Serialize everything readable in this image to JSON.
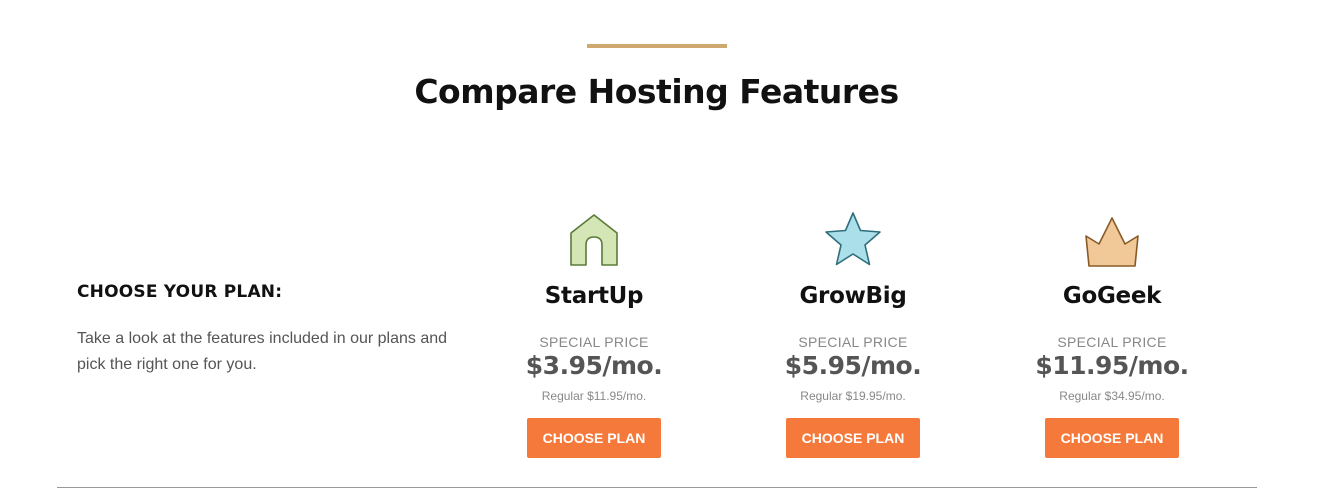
{
  "header": {
    "title": "Compare Hosting Features"
  },
  "intro": {
    "heading": "CHOOSE YOUR PLAN:",
    "text": "Take a look at the features included in our plans and pick the right one for you."
  },
  "plans": [
    {
      "name": "StartUp",
      "icon": "house-icon",
      "special_label": "SPECIAL PRICE",
      "price": "$3.95/mo.",
      "regular": "Regular $11.95/mo.",
      "button": "CHOOSE PLAN",
      "icon_color": "#d4e6b5"
    },
    {
      "name": "GrowBig",
      "icon": "star-icon",
      "special_label": "SPECIAL PRICE",
      "price": "$5.95/mo.",
      "regular": "Regular $19.95/mo.",
      "button": "CHOOSE PLAN",
      "icon_color": "#abe0ea"
    },
    {
      "name": "GoGeek",
      "icon": "crown-icon",
      "special_label": "SPECIAL PRICE",
      "price": "$11.95/mo.",
      "regular": "Regular $34.95/mo.",
      "button": "CHOOSE PLAN",
      "icon_color": "#f1c898"
    }
  ],
  "colors": {
    "accent": "#cfa870",
    "button": "#f5793b"
  }
}
